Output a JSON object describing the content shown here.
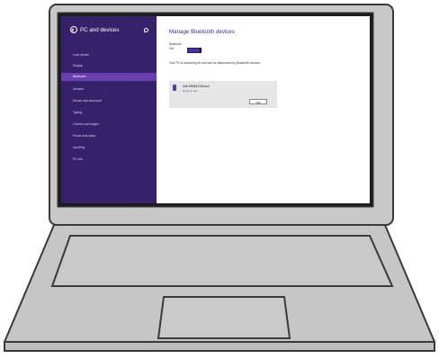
{
  "sidebar": {
    "title": "PC and devices",
    "items": [
      {
        "label": "Lock screen"
      },
      {
        "label": "Display"
      },
      {
        "label": "Bluetooth",
        "active": true
      },
      {
        "label": "Devices"
      },
      {
        "label": "Mouse and touchpad"
      },
      {
        "label": "Typing"
      },
      {
        "label": "Corners and edges"
      },
      {
        "label": "Power and sleep"
      },
      {
        "label": "AutoPlay"
      },
      {
        "label": "PC info"
      }
    ]
  },
  "main": {
    "title": "Manage Bluetooth devices",
    "bluetooth_label": "Bluetooth",
    "bluetooth_state": "On",
    "description": "Your PC is searching for and can be discovered by Bluetooth devices.",
    "device": {
      "name": "Dell WM615 Mouse",
      "status": "Ready to pair",
      "pair_label": "Pair"
    }
  },
  "colors": {
    "sidebar_bg": "#35226b",
    "sidebar_active": "#6a3fb0",
    "accent": "#4b2fa8",
    "device_card": "#e6e6e6"
  }
}
